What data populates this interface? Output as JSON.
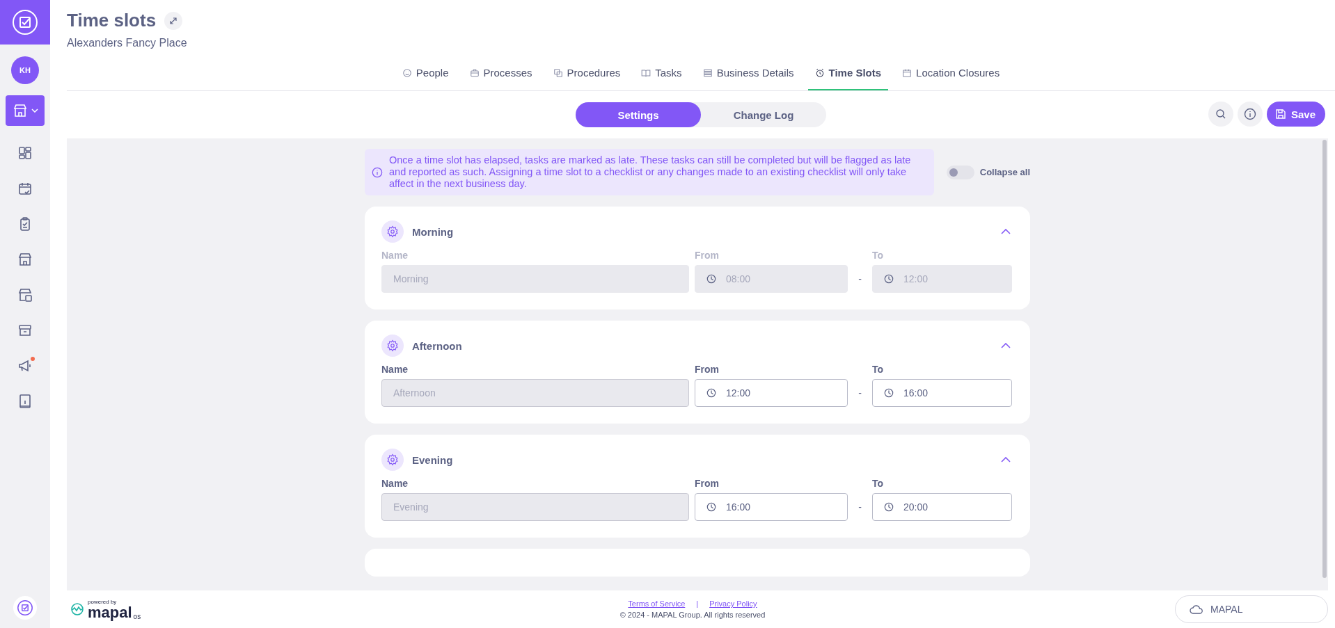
{
  "sidebar": {
    "avatar": "KH",
    "items": [
      {
        "kind": "store-menu",
        "selected": true,
        "notification": false
      },
      {
        "kind": "dashboard",
        "selected": false,
        "notification": false
      },
      {
        "kind": "calendar",
        "selected": false,
        "notification": false
      },
      {
        "kind": "clipboard",
        "selected": false,
        "notification": false
      },
      {
        "kind": "store",
        "selected": false,
        "notification": false
      },
      {
        "kind": "store-calendar",
        "selected": false,
        "notification": false
      },
      {
        "kind": "archive",
        "selected": false,
        "notification": false
      },
      {
        "kind": "megaphone",
        "selected": false,
        "notification": true
      },
      {
        "kind": "info-book",
        "selected": false,
        "notification": false
      }
    ]
  },
  "header": {
    "title": "Time slots",
    "subtitle": "Alexanders Fancy Place"
  },
  "tabs": [
    {
      "kind": "smile",
      "label": "People",
      "selected": false
    },
    {
      "kind": "briefcase",
      "label": "Processes",
      "selected": false
    },
    {
      "kind": "copies",
      "label": "Procedures",
      "selected": false
    },
    {
      "kind": "book",
      "label": "Tasks",
      "selected": false
    },
    {
      "kind": "list",
      "label": "Business Details",
      "selected": false
    },
    {
      "kind": "alarm",
      "label": "Time Slots",
      "selected": true
    },
    {
      "kind": "calendar",
      "label": "Location Closures",
      "selected": false
    }
  ],
  "segments": [
    {
      "label": "Settings",
      "selected": true
    },
    {
      "label": "Change Log",
      "selected": false
    }
  ],
  "save_button": "Save",
  "banner": "Once a time slot has elapsed, tasks are marked as late. These tasks can still be completed but will be flagged as late and reported as such. Assigning a time slot to a checklist or any changes made to an existing checklist will only take affect in the next business day.",
  "collapse_toggle": {
    "label": "Collapse all",
    "on": false
  },
  "time_slots": [
    {
      "title": "Morning",
      "expanded": true,
      "disabled": true,
      "name_label": "Name",
      "name": "Morning",
      "from_label": "From",
      "from": "08:00",
      "separator": "-",
      "to_label": "To",
      "to": "12:00"
    },
    {
      "title": "Afternoon",
      "expanded": true,
      "disabled": false,
      "name_label": "Name",
      "name": "Afternoon",
      "from_label": "From",
      "from": "12:00",
      "separator": "-",
      "to_label": "To",
      "to": "16:00"
    },
    {
      "title": "Evening",
      "expanded": true,
      "disabled": false,
      "name_label": "Name",
      "name": "Evening",
      "from_label": "From",
      "from": "16:00",
      "separator": "-",
      "to_label": "To",
      "to": "20:00"
    }
  ],
  "footer": {
    "powered_by": "powered by",
    "brand": "mapal",
    "brand_suffix": "os",
    "links": [
      "Terms of Service",
      "Privacy Policy"
    ],
    "separator": "|",
    "copyright": "© 2024 - MAPAL Group. All rights reserved",
    "switch_button": "MAPAL"
  }
}
